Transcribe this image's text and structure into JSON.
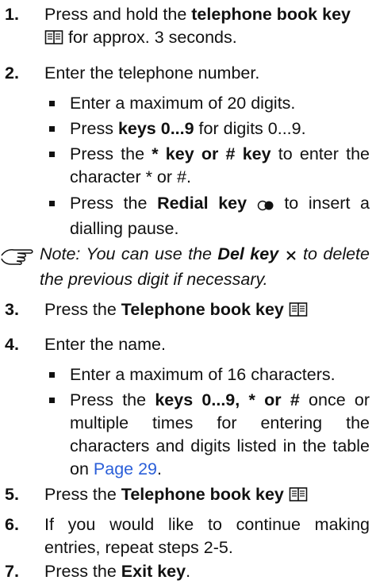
{
  "steps": [
    {
      "num": "1.",
      "pre": "Press and hold the ",
      "bold": "telephone book key",
      "post": " for approx. 3 seconds."
    },
    {
      "num": "2.",
      "text": "Enter the telephone number."
    },
    {
      "num": "3.",
      "pre": "Press the ",
      "bold": "Telephone book key"
    },
    {
      "num": "4.",
      "text": "Enter the name."
    },
    {
      "num": "5.",
      "pre": "Press the ",
      "bold": "Telephone book key"
    },
    {
      "num": "6.",
      "text": "If you would like to continue making entries, repeat steps 2-5."
    },
    {
      "num": "7.",
      "pre": "Press the ",
      "bold": "Exit key",
      "post": "."
    }
  ],
  "step2_bullets": [
    {
      "text": "Enter a maximum of 20 digits."
    },
    {
      "pre": "Press ",
      "bold": "keys 0...9",
      "post": " for digits 0...9."
    },
    {
      "pre": "Press the ",
      "bold": "* key or # key",
      "post": " to enter the character * or #."
    },
    {
      "pre": "Press the ",
      "bold": "Redial key",
      "post": " to insert a dialling pause."
    }
  ],
  "note": {
    "pre": "Note: You can use the ",
    "bold": "Del key",
    "post": " to delete the previous digit if necessary."
  },
  "step4_bullets": [
    {
      "text": "Enter a maximum of 16 characters."
    },
    {
      "pre": "Press the ",
      "bold": "keys 0...9, * or #",
      "post": " once or multiple times for entering the characters and digits listed in the table on ",
      "link": "Page 29",
      "end": "."
    }
  ],
  "icons": {
    "book": "telephone-book-icon",
    "redial": "redial-icon",
    "del": "del-x-icon",
    "note": "pointing-hand-icon"
  },
  "colors": {
    "text": "#111111",
    "link": "#2b5fd9"
  }
}
